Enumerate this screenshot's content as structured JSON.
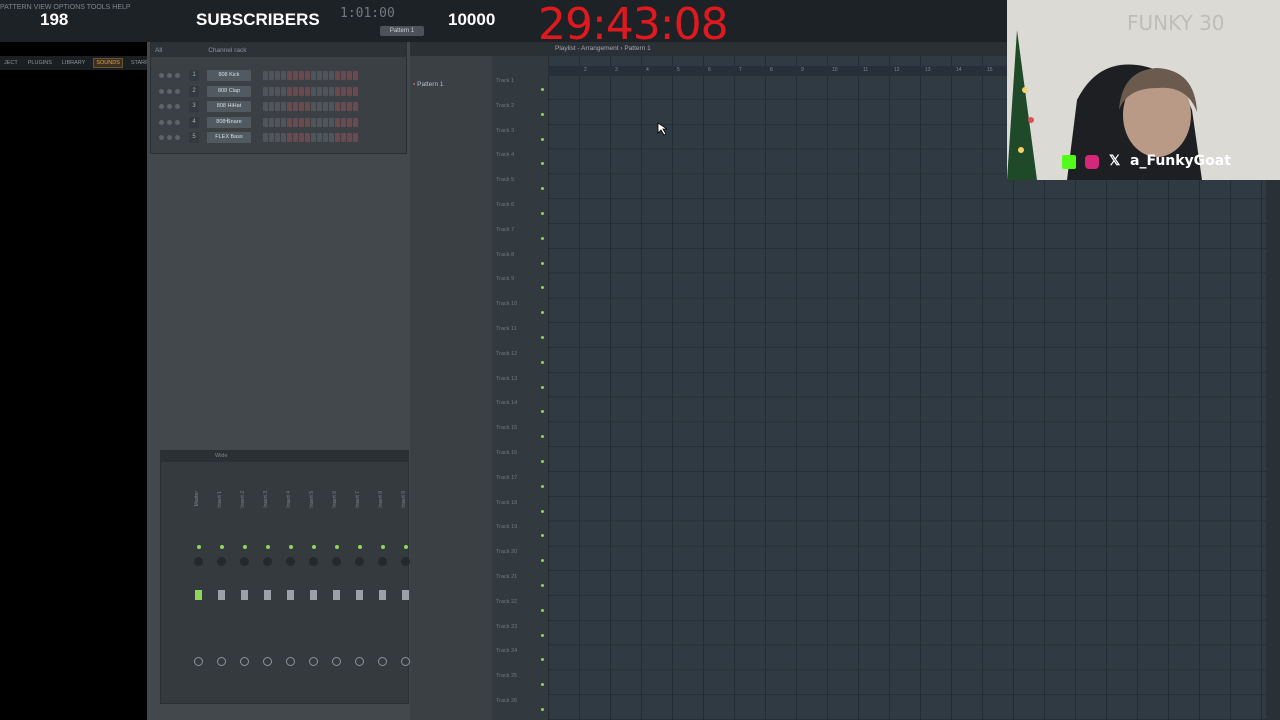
{
  "overlay": {
    "count": "198",
    "label": "SUBSCRIBERS",
    "goal": "10000",
    "timer": "29:43:08"
  },
  "menu": {
    "items": "PATTERN  VIEW OPTIONS TOOLS HELP",
    "song_pos": "1:01:00"
  },
  "browser": {
    "tabs": [
      "JECT",
      "PLUGINS",
      "LIBRARY",
      "SOUNDS",
      "STARRED"
    ]
  },
  "channel_rack": {
    "title": "Channel rack",
    "filter": "All",
    "channels": [
      {
        "num": "1",
        "name": "808 Kick"
      },
      {
        "num": "2",
        "name": "808 Clap"
      },
      {
        "num": "3",
        "name": "808 HiHat"
      },
      {
        "num": "4",
        "name": "808 Snare"
      },
      {
        "num": "5",
        "name": "FLEX Bass"
      }
    ]
  },
  "mixer": {
    "title": "Wide",
    "master": "Master",
    "inserts": [
      "Insert 1",
      "Insert 2",
      "Insert 3",
      "Insert 4",
      "Insert 5",
      "Insert 6",
      "Insert 7",
      "Insert 8",
      "Insert 9"
    ]
  },
  "playlist": {
    "title": "Playlist - Arrangement › Pattern 1",
    "pattern": "Pattern 1",
    "pattern_selector": "Pattern 1",
    "tracks": [
      "Track 1",
      "Track 2",
      "Track 3",
      "Track 4",
      "Track 5",
      "Track 6",
      "Track 7",
      "Track 8",
      "Track 9",
      "Track 10",
      "Track 11",
      "Track 12",
      "Track 13",
      "Track 14",
      "Track 15",
      "Track 16",
      "Track 17",
      "Track 18",
      "Track 19",
      "Track 20",
      "Track 21",
      "Track 22",
      "Track 23",
      "Track 24",
      "Track 25",
      "Track 26"
    ],
    "bars": [
      "2",
      "3",
      "4",
      "5",
      "6",
      "7",
      "8",
      "9",
      "10",
      "11",
      "12",
      "13",
      "14",
      "15"
    ]
  },
  "webcam": {
    "handle": "a_FunkyGoat"
  },
  "colors": {
    "timer": "#e0191f",
    "accent_orange": "#e8a23a",
    "led_green": "#8dd65a"
  }
}
